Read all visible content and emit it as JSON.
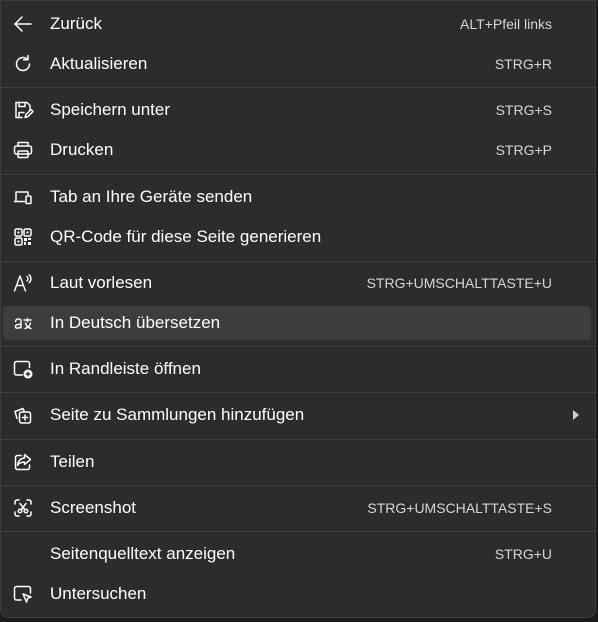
{
  "menu": {
    "items": [
      {
        "label": "Zurück",
        "shortcut": "ALT+Pfeil links",
        "icon": "arrow-left-icon"
      },
      {
        "label": "Aktualisieren",
        "shortcut": "STRG+R",
        "icon": "refresh-icon"
      },
      {
        "label": "Speichern unter",
        "shortcut": "STRG+S",
        "icon": "save-as-icon"
      },
      {
        "label": "Drucken",
        "shortcut": "STRG+P",
        "icon": "printer-icon"
      },
      {
        "label": "Tab an Ihre Geräte senden",
        "shortcut": "",
        "icon": "send-to-devices-icon"
      },
      {
        "label": "QR-Code für diese Seite generieren",
        "shortcut": "",
        "icon": "qr-code-icon"
      },
      {
        "label": "Laut vorlesen",
        "shortcut": "STRG+UMSCHALTTASTE+U",
        "icon": "read-aloud-icon"
      },
      {
        "label": "In Deutsch übersetzen",
        "shortcut": "",
        "icon": "translate-icon"
      },
      {
        "label": "In Randleiste öffnen",
        "shortcut": "",
        "icon": "sidebar-add-icon"
      },
      {
        "label": "Seite zu Sammlungen hinzufügen",
        "shortcut": "",
        "icon": "collections-add-icon"
      },
      {
        "label": "Teilen",
        "shortcut": "",
        "icon": "share-icon"
      },
      {
        "label": "Screenshot",
        "shortcut": "STRG+UMSCHALTTASTE+S",
        "icon": "screenshot-icon"
      },
      {
        "label": "Seitenquelltext anzeigen",
        "shortcut": "STRG+U",
        "icon": ""
      },
      {
        "label": "Untersuchen",
        "shortcut": "",
        "icon": "inspect-icon"
      }
    ]
  },
  "colors": {
    "menu_background": "#2c2c2c",
    "highlight": "#3d3d3d",
    "divider": "#3f3f3f",
    "text": "#ffffff",
    "shortcut_text": "#d6d6d6"
  }
}
